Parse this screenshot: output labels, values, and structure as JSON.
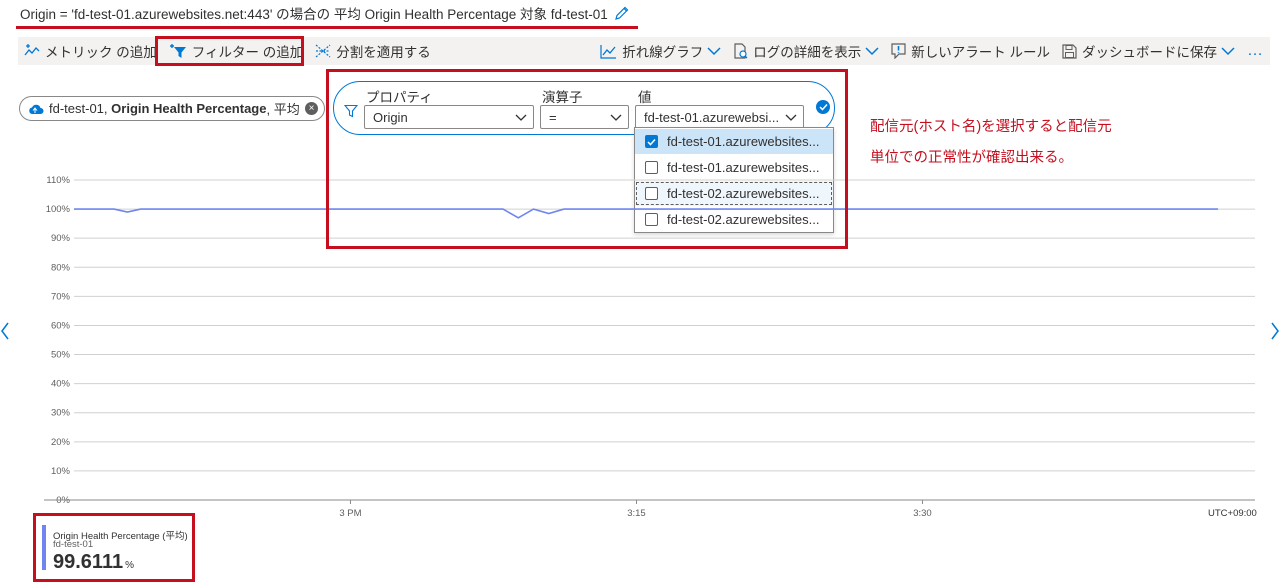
{
  "header": {
    "title": "Origin = 'fd-test-01.azurewebsites.net:443' の場合の 平均 Origin Health Percentage 対象 fd-test-01"
  },
  "toolbar": {
    "add_metric": "メトリック の追加",
    "add_filter": "フィルター の追加",
    "apply_split": "分割を適用する",
    "line_chart": "折れ線グラフ",
    "show_log_details": "ログの詳細を表示",
    "new_alert_rule": "新しいアラート ルール",
    "save_to_dashboard": "ダッシュボードに保存",
    "more": "…"
  },
  "metric_pill": {
    "resource": "fd-test-01,",
    "metric": "Origin Health Percentage",
    "aggregation": ", 平均"
  },
  "filter": {
    "property_label": "プロパティ",
    "property_value": "Origin",
    "operator_label": "演算子",
    "operator_value": "=",
    "value_label": "値",
    "value_value": "fd-test-01.azurewebsi...",
    "options": [
      {
        "label": "fd-test-01.azurewebsites...",
        "checked": true
      },
      {
        "label": "fd-test-01.azurewebsites...",
        "checked": false
      },
      {
        "label": "fd-test-02.azurewebsites...",
        "checked": false
      },
      {
        "label": "fd-test-02.azurewebsites...",
        "checked": false
      }
    ]
  },
  "annotation": {
    "line1": "配信元(ホスト名)を選択すると配信元",
    "line2": "単位での正常性が確認出来る。"
  },
  "chart_data": {
    "type": "line",
    "y_ticks": [
      "110%",
      "100%",
      "90%",
      "80%",
      "70%",
      "60%",
      "50%",
      "40%",
      "30%",
      "20%",
      "10%",
      "0%"
    ],
    "x_ticks": [
      "3 PM",
      "3:15",
      "3:30"
    ],
    "timezone": "UTC+09:00",
    "ylim": [
      0,
      110
    ],
    "grid": true,
    "series": [
      {
        "color": "#6f86f0",
        "points": [
          [
            0,
            100
          ],
          [
            0.7,
            100
          ],
          [
            1.4,
            100
          ],
          [
            2.1,
            100
          ],
          [
            2.8,
            99
          ],
          [
            3.5,
            100
          ],
          [
            4.2,
            100
          ],
          [
            21,
            100
          ],
          [
            22.5,
            100
          ],
          [
            23.3,
            97
          ],
          [
            24.1,
            100
          ],
          [
            24.9,
            98.5
          ],
          [
            25.7,
            100
          ],
          [
            26.5,
            100
          ],
          [
            45,
            100
          ],
          [
            60,
            100
          ]
        ]
      }
    ]
  },
  "legend": {
    "title": "Origin Health Percentage (平均)",
    "subtitle": "fd-test-01",
    "value": "99.6111",
    "unit": "%"
  }
}
